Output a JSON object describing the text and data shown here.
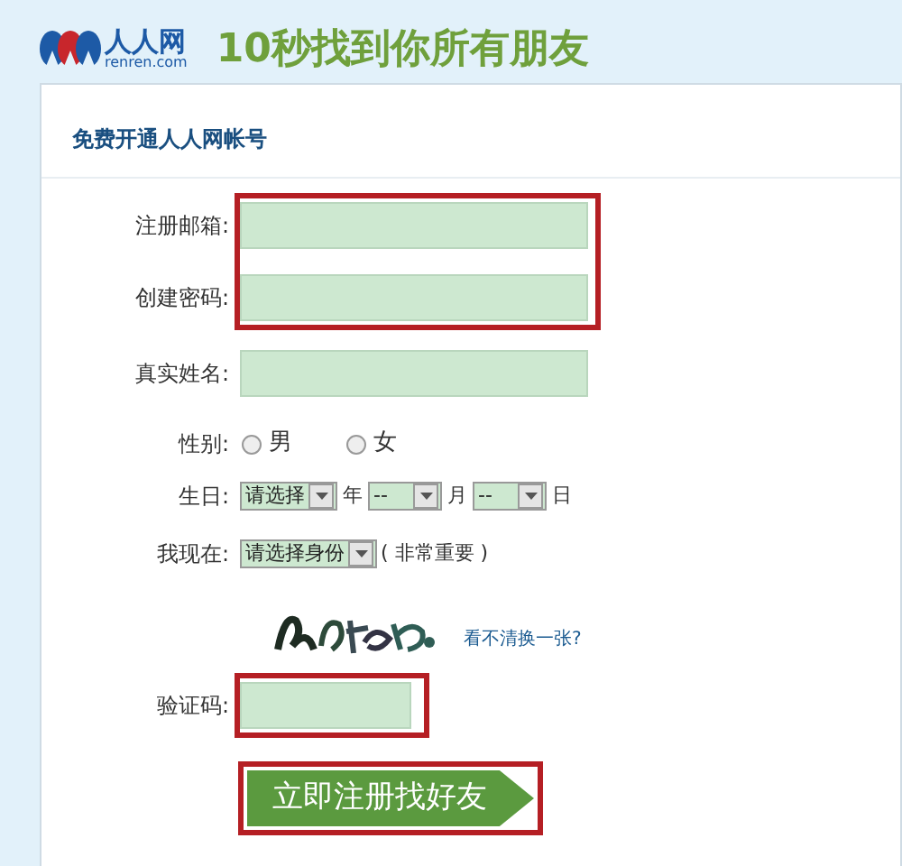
{
  "header": {
    "logo_text": "人人网",
    "logo_domain": "renren.com",
    "slogan": "10秒找到你所有朋友"
  },
  "form": {
    "title": "免费开通人人网帐号",
    "rows": [
      {
        "kind": "text",
        "label": "注册邮箱:",
        "highlighted": true
      },
      {
        "kind": "text",
        "label": "创建密码:",
        "highlighted": true
      },
      {
        "kind": "text",
        "label": "真实姓名:",
        "highlighted": false
      },
      {
        "kind": "radio",
        "label": "性别:",
        "options": [
          {
            "label": "男",
            "selected": false
          },
          {
            "label": "女",
            "selected": false
          }
        ]
      },
      {
        "kind": "date",
        "label": "生日:",
        "parts": [
          {
            "value": "请选择",
            "unit": "年"
          },
          {
            "value": "--",
            "unit": "月"
          },
          {
            "value": "--",
            "unit": "日"
          }
        ]
      },
      {
        "kind": "select",
        "label": "我现在:",
        "value": "请选择身份",
        "note": "( 非常重要 )"
      },
      {
        "kind": "captcha",
        "link": "看不清换一张?"
      },
      {
        "kind": "code",
        "label": "验证码:",
        "highlighted": true
      }
    ],
    "submit": {
      "label": "立即注册找好友",
      "highlighted": true
    }
  }
}
